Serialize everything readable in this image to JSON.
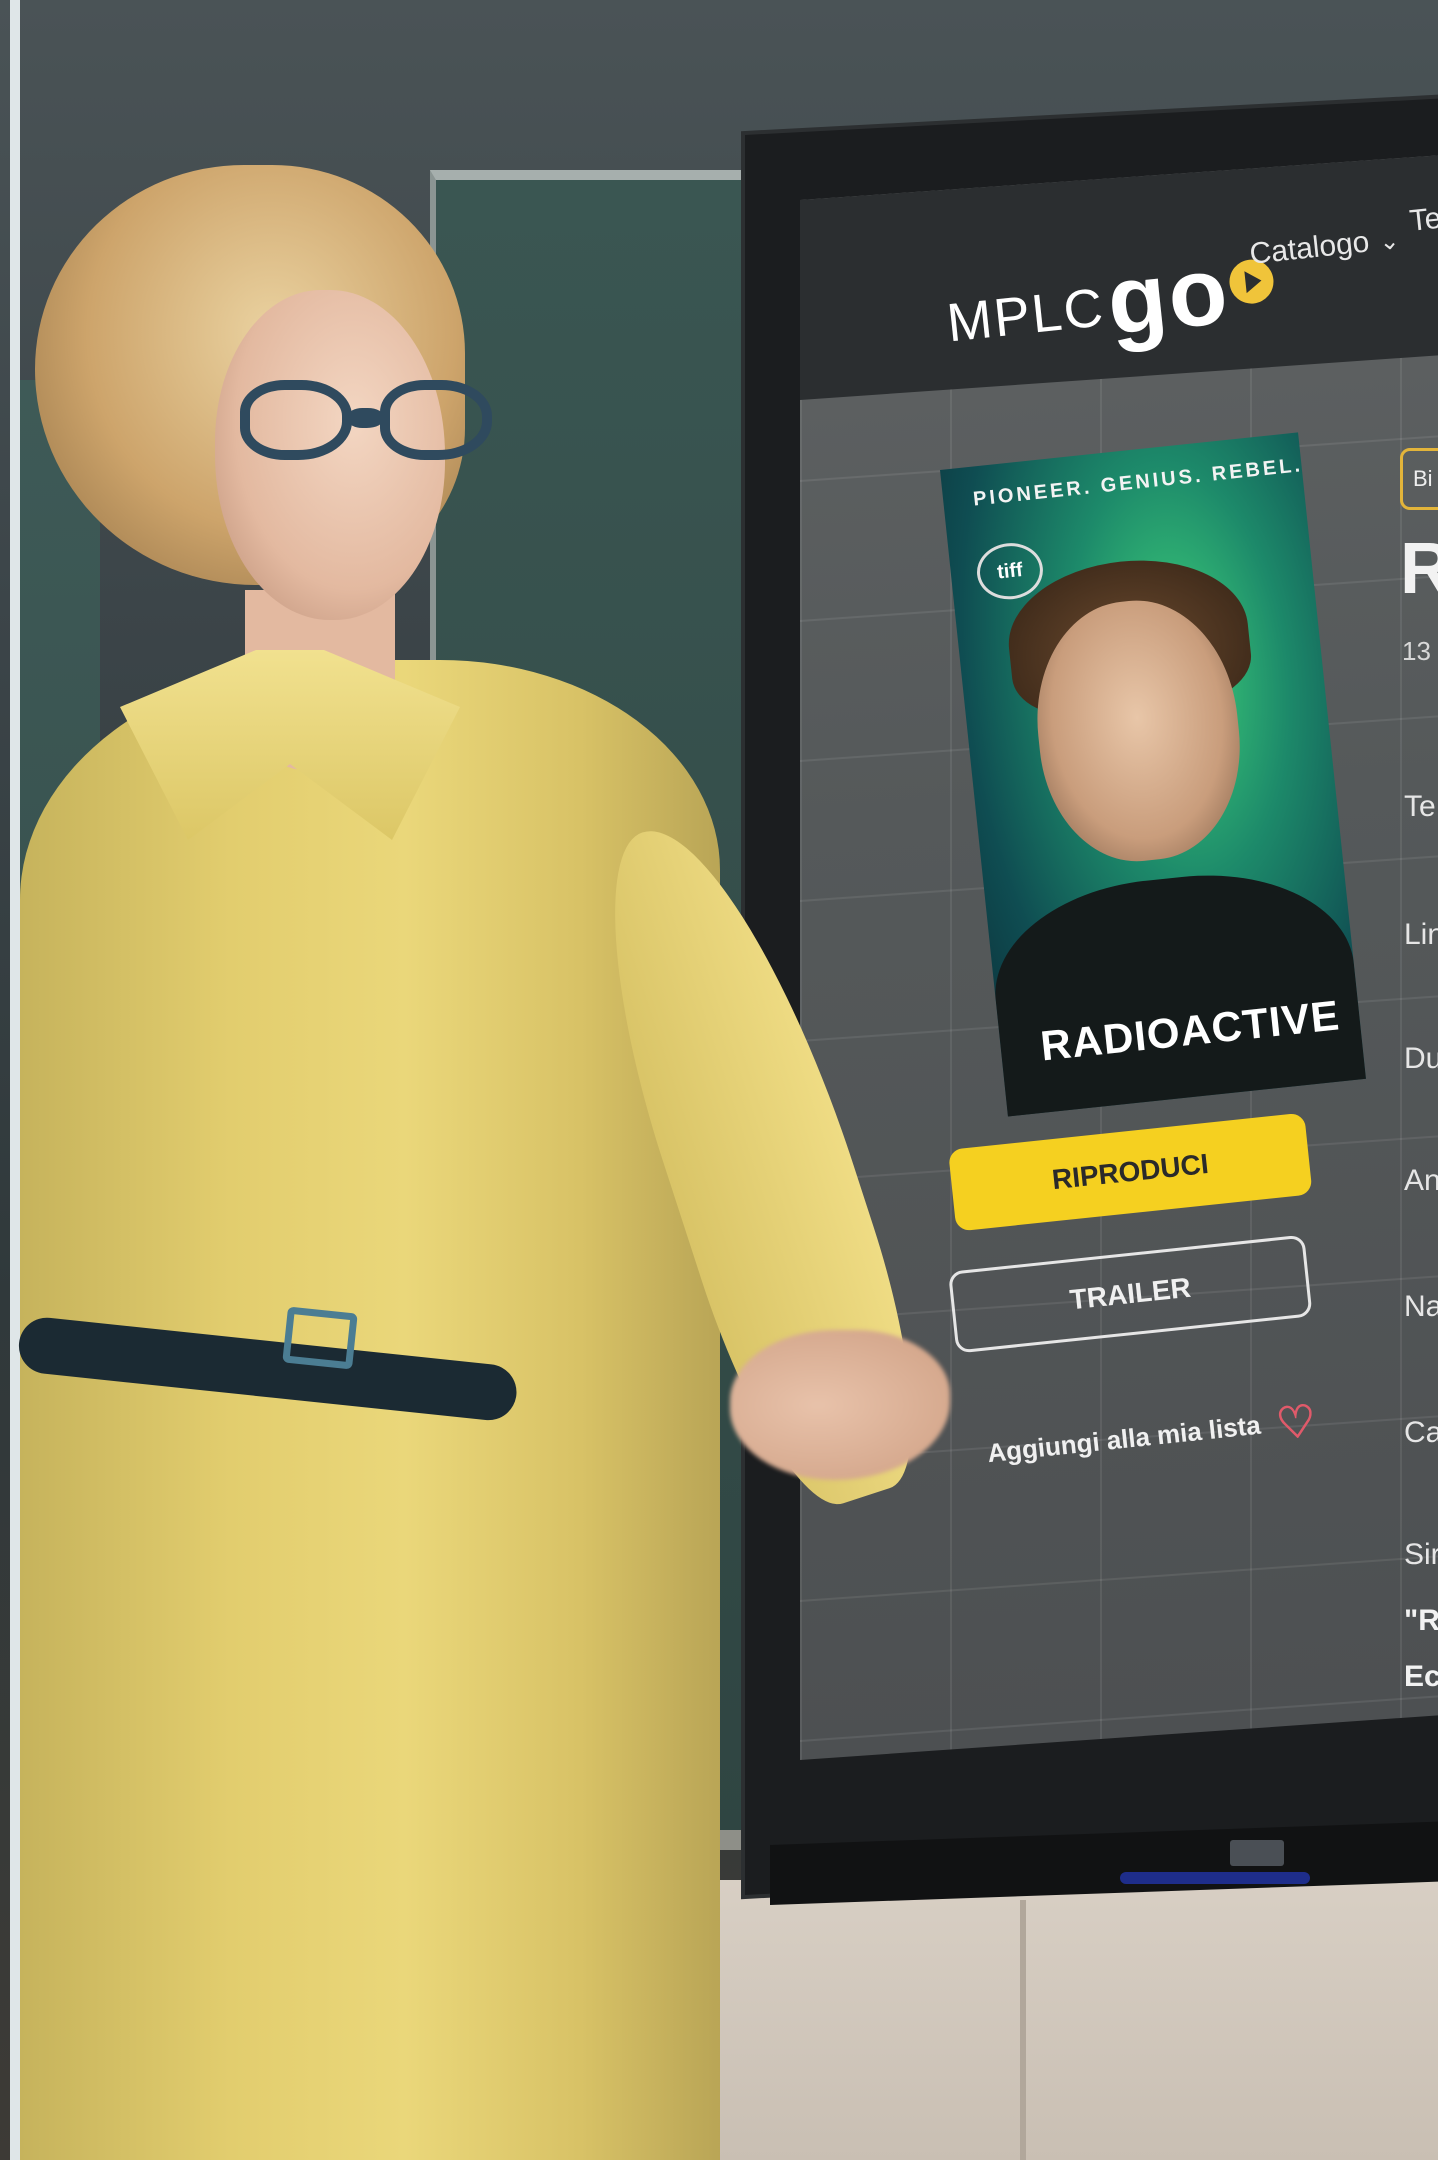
{
  "app": {
    "logo": {
      "text": "MPLC",
      "go": "go"
    },
    "nav": {
      "catalogo": "Catalogo",
      "next_cut": "Te"
    }
  },
  "poster": {
    "tagline": "PIONEER. GENIUS. REBEL.",
    "festival_badge": "tiff",
    "title": "RADIOACTIVE"
  },
  "actions": {
    "play_label": "RIPRODUCI",
    "trailer_label": "TRAILER",
    "add_to_list_label": "Aggiungi alla mia lista"
  },
  "details": {
    "badge": "Bi",
    "title_cut": "R",
    "meta_cut": "13",
    "rows": [
      "Te",
      "Lin",
      "Du",
      "An",
      "Na",
      "Ca",
      "Sir"
    ],
    "synopsis_lines": [
      "\"Ra",
      "Ec"
    ]
  },
  "colors": {
    "accent_yellow": "#f5d020",
    "heart": "#e05a6a",
    "screen_bar": "#2b2e30"
  }
}
